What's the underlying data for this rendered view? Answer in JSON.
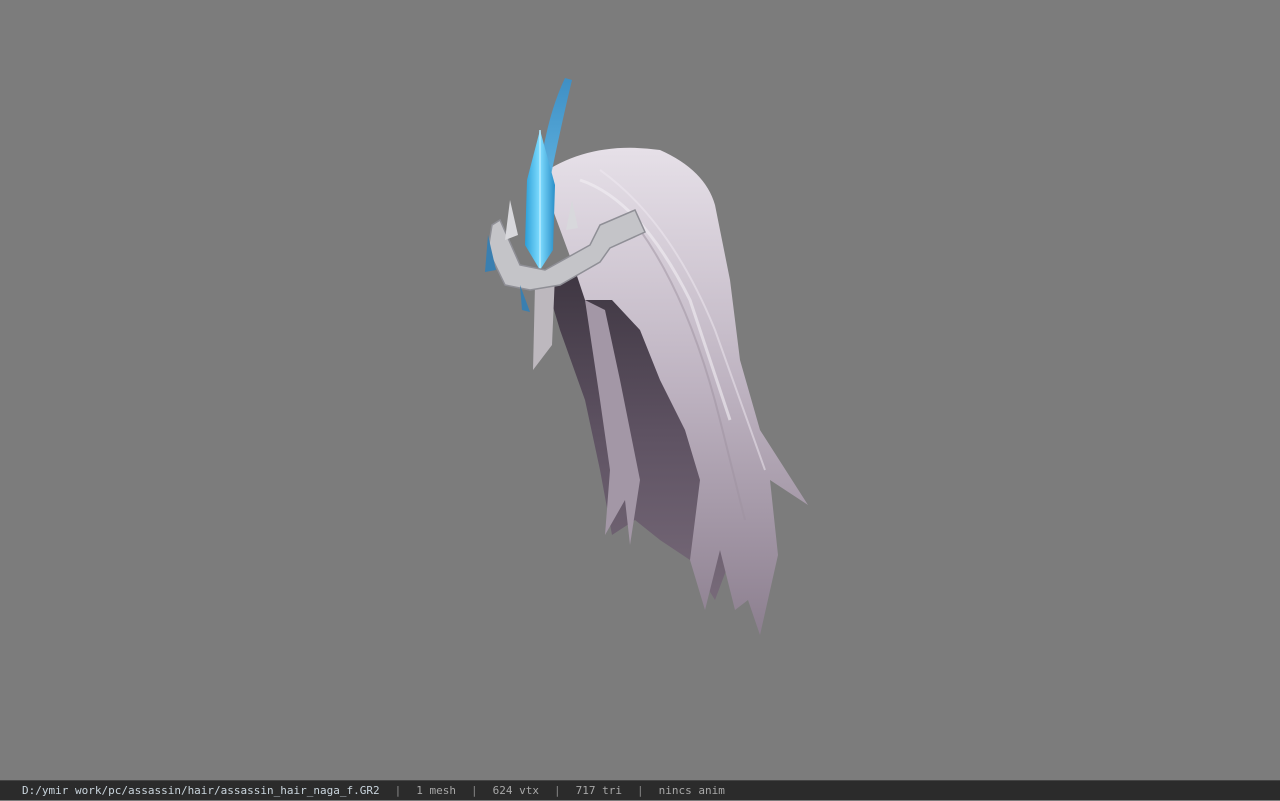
{
  "viewer": {
    "background_color": "#7c7c7c",
    "model": {
      "subject": "assassin hair with blue crystal tiara",
      "hair_color": "#d9d2dc",
      "hair_shadow_color": "#6a5f6c",
      "crystal_color": "#4cc3f0",
      "metal_color": "#c8c8cc"
    }
  },
  "status_bar": {
    "file_path": "D:/ymir work/pc/assassin/hair/assassin_hair_naga_f.GR2",
    "separator": "|",
    "mesh_count": "1 mesh",
    "vertex_count": "624 vtx",
    "triangle_count": "717 tri",
    "animation": "nincs anim"
  }
}
